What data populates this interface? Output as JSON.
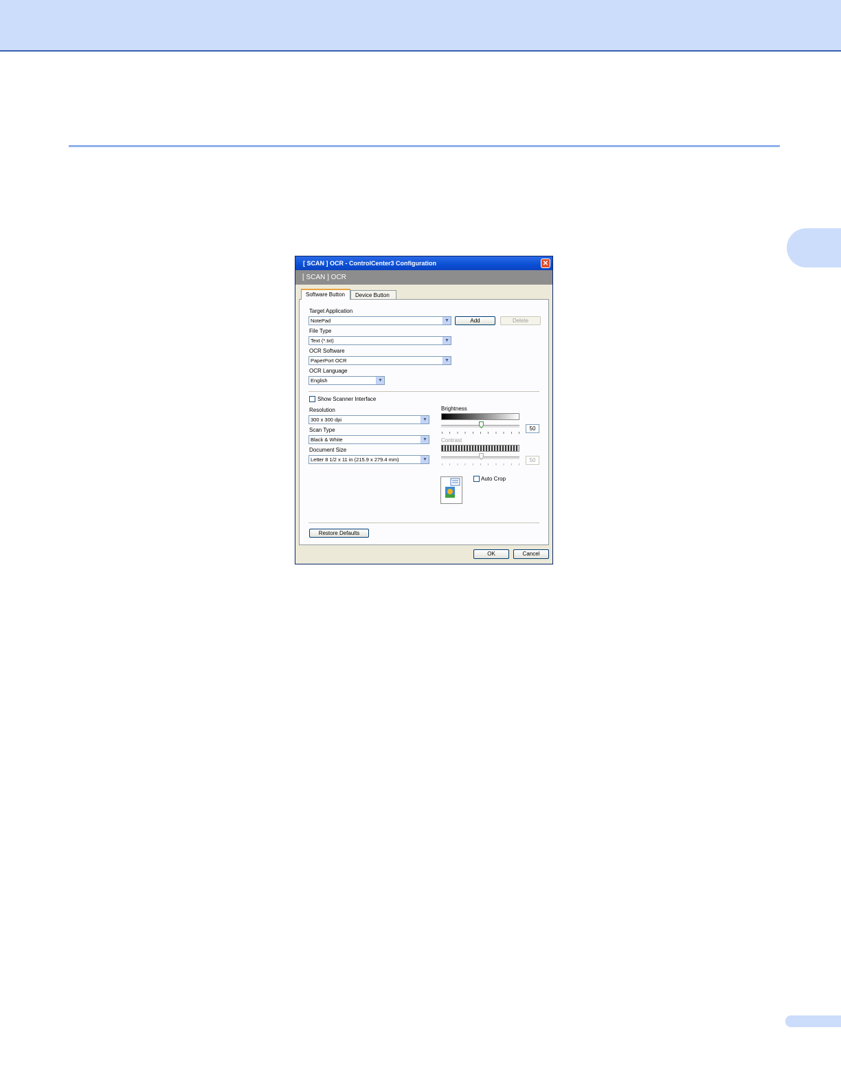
{
  "dialog": {
    "title": "[  SCAN  ]  OCR - ControlCenter3 Configuration",
    "header": "[  SCAN  ]  OCR",
    "tabs": [
      "Software Button",
      "Device Button"
    ],
    "target_application": {
      "label": "Target Application",
      "value": "NotePad"
    },
    "add_label": "Add",
    "delete_label": "Delete",
    "file_type": {
      "label": "File Type",
      "value": "Text (*.txt)"
    },
    "ocr_software": {
      "label": "OCR Software",
      "value": "PaperPort OCR"
    },
    "ocr_language": {
      "label": "OCR Language",
      "value": "English"
    },
    "show_scanner_interface": {
      "label": "Show Scanner Interface",
      "checked": false
    },
    "resolution": {
      "label": "Resolution",
      "value": "300 x 300 dpi"
    },
    "scan_type": {
      "label": "Scan Type",
      "value": "Black & White"
    },
    "document_size": {
      "label": "Document Size",
      "value": "Letter 8 1/2 x 11 in (215.9 x 279.4 mm)"
    },
    "brightness": {
      "label": "Brightness",
      "value": "50"
    },
    "contrast": {
      "label": "Contrast",
      "value": "50"
    },
    "auto_crop": {
      "label": "Auto Crop",
      "checked": false
    },
    "restore_defaults_label": "Restore Defaults",
    "ok_label": "OK",
    "cancel_label": "Cancel"
  },
  "colors": {
    "page_accent": "#ccdcfb",
    "titlebar": "#0a4fd4",
    "tab_highlight": "#e8a33d"
  }
}
